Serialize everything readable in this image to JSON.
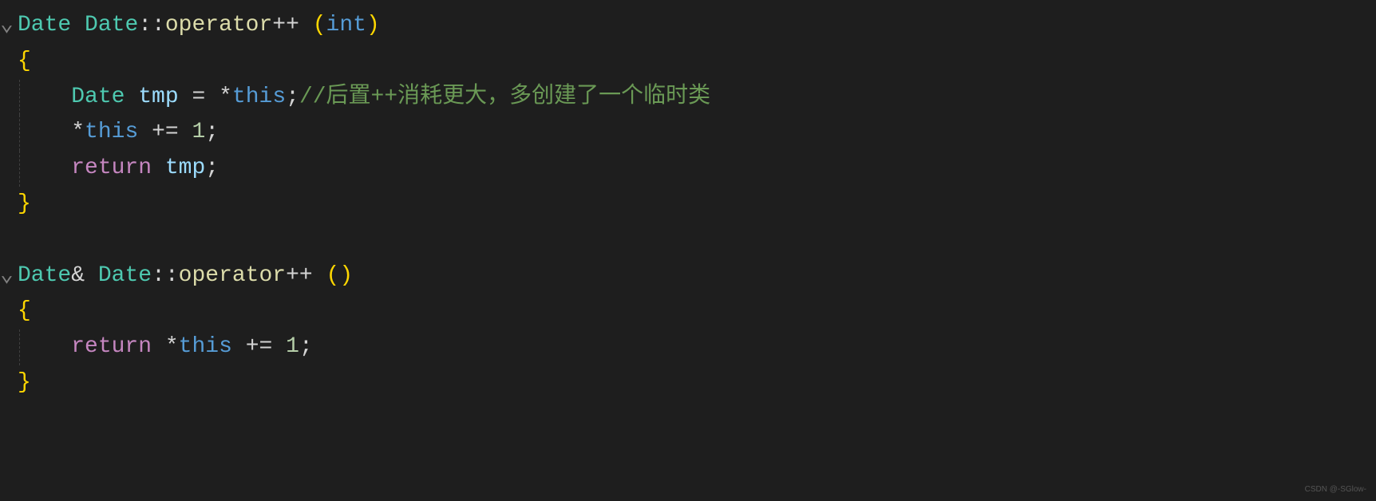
{
  "code": {
    "lines": [
      {
        "fold": "⌄",
        "tokens": [
          {
            "cls": "type",
            "text": "Date"
          },
          {
            "cls": "punct",
            "text": " "
          },
          {
            "cls": "class-name",
            "text": "Date"
          },
          {
            "cls": "punct",
            "text": "::"
          },
          {
            "cls": "func-name",
            "text": "operator"
          },
          {
            "cls": "punct",
            "text": "++ "
          },
          {
            "cls": "paren",
            "text": "("
          },
          {
            "cls": "keyword",
            "text": "int"
          },
          {
            "cls": "paren",
            "text": ")"
          }
        ]
      },
      {
        "tokens": [
          {
            "cls": "brace",
            "text": "{"
          }
        ]
      },
      {
        "indent": true,
        "tokens": [
          {
            "cls": "punct",
            "text": "    "
          },
          {
            "cls": "type",
            "text": "Date"
          },
          {
            "cls": "punct",
            "text": " "
          },
          {
            "cls": "variable",
            "text": "tmp"
          },
          {
            "cls": "punct",
            "text": " "
          },
          {
            "cls": "operator",
            "text": "="
          },
          {
            "cls": "punct",
            "text": " "
          },
          {
            "cls": "operator",
            "text": "*"
          },
          {
            "cls": "this-kw",
            "text": "this"
          },
          {
            "cls": "punct",
            "text": ";"
          },
          {
            "cls": "comment",
            "text": "//后置++消耗更大，多创建了一个临时类"
          }
        ]
      },
      {
        "indent": true,
        "tokens": [
          {
            "cls": "punct",
            "text": "    "
          },
          {
            "cls": "operator",
            "text": "*"
          },
          {
            "cls": "this-kw",
            "text": "this"
          },
          {
            "cls": "punct",
            "text": " "
          },
          {
            "cls": "operator",
            "text": "+="
          },
          {
            "cls": "punct",
            "text": " "
          },
          {
            "cls": "number",
            "text": "1"
          },
          {
            "cls": "punct",
            "text": ";"
          }
        ]
      },
      {
        "indent": true,
        "tokens": [
          {
            "cls": "punct",
            "text": "    "
          },
          {
            "cls": "return-kw",
            "text": "return"
          },
          {
            "cls": "punct",
            "text": " "
          },
          {
            "cls": "variable",
            "text": "tmp"
          },
          {
            "cls": "punct",
            "text": ";"
          }
        ]
      },
      {
        "tokens": [
          {
            "cls": "brace",
            "text": "}"
          }
        ]
      },
      {
        "tokens": [
          {
            "cls": "punct",
            "text": " "
          }
        ]
      },
      {
        "fold": "⌄",
        "tokens": [
          {
            "cls": "type",
            "text": "Date"
          },
          {
            "cls": "amp",
            "text": "&"
          },
          {
            "cls": "punct",
            "text": " "
          },
          {
            "cls": "class-name",
            "text": "Date"
          },
          {
            "cls": "punct",
            "text": "::"
          },
          {
            "cls": "func-name",
            "text": "operator"
          },
          {
            "cls": "punct",
            "text": "++ "
          },
          {
            "cls": "paren",
            "text": "("
          },
          {
            "cls": "paren",
            "text": ")"
          }
        ]
      },
      {
        "tokens": [
          {
            "cls": "brace",
            "text": "{"
          }
        ]
      },
      {
        "indent": true,
        "tokens": [
          {
            "cls": "punct",
            "text": "    "
          },
          {
            "cls": "return-kw",
            "text": "return"
          },
          {
            "cls": "punct",
            "text": " "
          },
          {
            "cls": "operator",
            "text": "*"
          },
          {
            "cls": "this-kw",
            "text": "this"
          },
          {
            "cls": "punct",
            "text": " "
          },
          {
            "cls": "operator",
            "text": "+="
          },
          {
            "cls": "punct",
            "text": " "
          },
          {
            "cls": "number",
            "text": "1"
          },
          {
            "cls": "punct",
            "text": ";"
          }
        ]
      },
      {
        "tokens": [
          {
            "cls": "brace",
            "text": "}"
          }
        ]
      }
    ]
  },
  "watermark": "CSDN @-SGlow-"
}
